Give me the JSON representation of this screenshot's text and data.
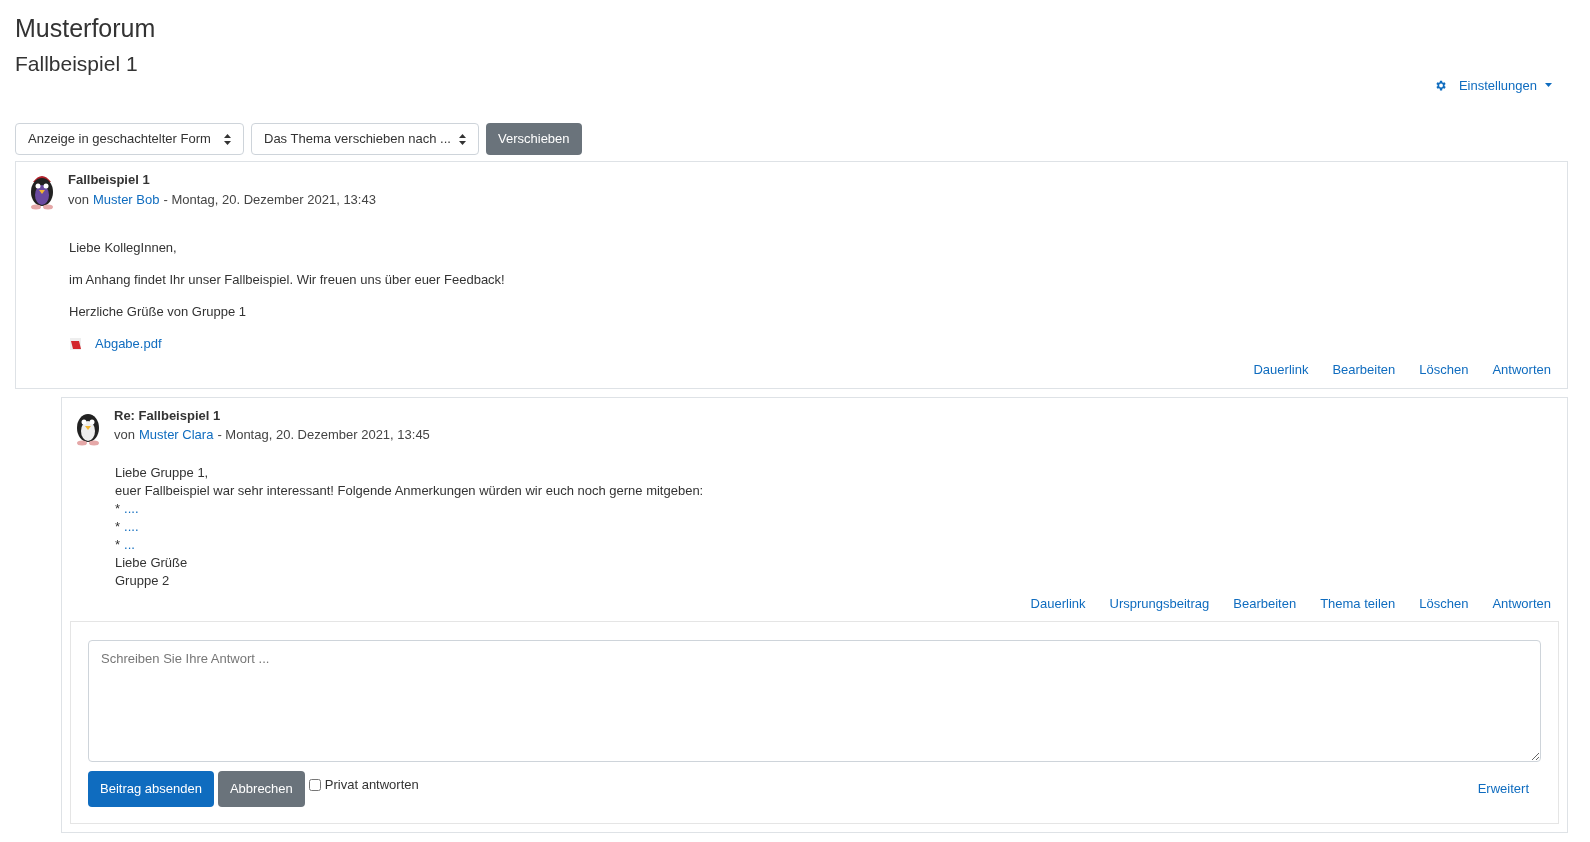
{
  "heading": "Musterforum",
  "subheading": "Fallbeispiel 1",
  "settings_menu": {
    "label": "Einstellungen"
  },
  "toolbar": {
    "display_select": "Anzeige in geschachtelter Form",
    "move_select": "Das Thema verschieben nach ...",
    "move_button": "Verschieben"
  },
  "posts": [
    {
      "title": "Fallbeispiel 1",
      "by": "von",
      "author": "Muster Bob",
      "date": "- Montag, 20. Dezember 2021, 13:43",
      "kind": "topic",
      "lines": [
        {
          "kind": "text",
          "text": "Liebe KollegInnen,"
        },
        {
          "kind": "text",
          "text": "im Anhang findet Ihr unser Fallbeispiel. Wir freuen uns über euer Feedback!"
        },
        {
          "kind": "text",
          "text": "Herzliche Grüße von Gruppe 1"
        }
      ],
      "attachment": "Abgabe.pdf",
      "actions": [
        "Dauerlink",
        "Bearbeiten",
        "Löschen",
        "Antworten"
      ]
    },
    {
      "title": "Re: Fallbeispiel 1",
      "by": "von",
      "author": "Muster Clara",
      "date": "- Montag, 20. Dezember 2021, 13:45",
      "kind": "reply",
      "lines": [
        {
          "kind": "text",
          "text": "Liebe Gruppe 1,"
        },
        {
          "kind": "text",
          "text": "euer Fallbeispiel war sehr interessant! Folgende Anmerkungen würden wir euch noch gerne mitgeben:"
        },
        {
          "kind": "bullet",
          "mark": "*",
          "text": "...."
        },
        {
          "kind": "bullet",
          "mark": "*",
          "text": "...."
        },
        {
          "kind": "bullet",
          "mark": "*",
          "text": "..."
        },
        {
          "kind": "text",
          "text": "Liebe Grüße"
        },
        {
          "kind": "text",
          "text": "Gruppe 2"
        }
      ],
      "actions": [
        "Dauerlink",
        "Ursprungsbeitrag",
        "Bearbeiten",
        "Thema teilen",
        "Löschen",
        "Antworten"
      ],
      "reply_form": {
        "placeholder": "Schreiben Sie Ihre Antwort ...",
        "submit": "Beitrag absenden",
        "cancel": "Abbrechen",
        "private": {
          "label": "Privat antworten",
          "checked": false
        },
        "advanced": "Erweitert"
      }
    }
  ]
}
